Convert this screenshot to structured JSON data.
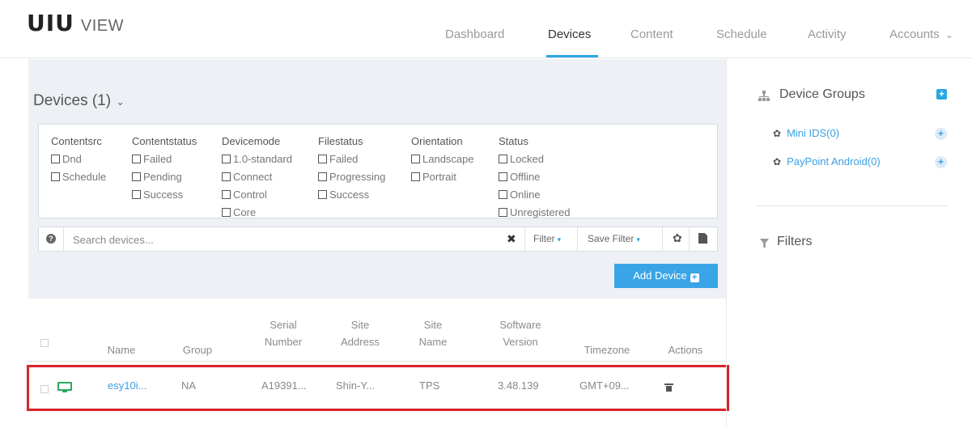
{
  "header": {
    "logo_mark": "UIU",
    "logo_word": "VIEW",
    "nav": [
      {
        "label": "Dashboard"
      },
      {
        "label": "Devices"
      },
      {
        "label": "Content"
      },
      {
        "label": "Schedule"
      },
      {
        "label": "Activity"
      },
      {
        "label": "Accounts"
      }
    ],
    "accounts_caret": "⌄"
  },
  "devices": {
    "title": "Devices (1)",
    "title_caret": "⌄"
  },
  "filters": {
    "groups": [
      {
        "heading": "Contentsrc",
        "options": [
          "Dnd",
          "Schedule"
        ]
      },
      {
        "heading": "Contentstatus",
        "options": [
          "Failed",
          "Pending",
          "Success"
        ]
      },
      {
        "heading": "Devicemode",
        "options": [
          "1.0-standard",
          "Connect",
          "Control",
          "Core"
        ]
      },
      {
        "heading": "Filestatus",
        "options": [
          "Failed",
          "Progressing",
          "Success"
        ]
      },
      {
        "heading": "Orientation",
        "options": [
          "Landscape",
          "Portrait"
        ]
      },
      {
        "heading": "Status",
        "options": [
          "Locked",
          "Offline",
          "Online",
          "Unregistered"
        ]
      }
    ]
  },
  "search": {
    "help_icon": "?",
    "placeholder": "Search devices...",
    "value": "",
    "clear_icon": "✖",
    "filter_label": "Filter",
    "save_filter_label": "Save Filter",
    "caret": "▾",
    "gear_icon": "✿"
  },
  "add_device": {
    "label": "Add Device",
    "plus": "+"
  },
  "table": {
    "columns": [
      {
        "line1": "",
        "line2": "Name"
      },
      {
        "line1": "",
        "line2": "Group"
      },
      {
        "line1": "Serial",
        "line2": "Number"
      },
      {
        "line1": "Site",
        "line2": "Address"
      },
      {
        "line1": "Site",
        "line2": "Name"
      },
      {
        "line1": "Software",
        "line2": "Version"
      },
      {
        "line1": "",
        "line2": "Timezone"
      },
      {
        "line1": "",
        "line2": "Actions"
      }
    ],
    "rows": [
      {
        "name": "esy10i...",
        "group": "NA",
        "serial": "A19391...",
        "site_address": "Shin-Y...",
        "site_name": "TPS",
        "software": "3.48.139",
        "timezone": "GMT+09...",
        "status_color": "#2ea85f"
      }
    ]
  },
  "sidebar": {
    "groups_title": "Device Groups",
    "add_icon": "+",
    "groups": [
      {
        "label": "Mini IDS(0)"
      },
      {
        "label": "PayPoint Android(0)"
      }
    ],
    "gear_glyph": "✿",
    "plus_glyph": "+",
    "filters_title": "Filters"
  },
  "colors": {
    "accent": "#2ba6e1",
    "highlight_border": "#d8232a",
    "online_green": "#2ea85f",
    "panel_bg": "#edf0f4"
  }
}
